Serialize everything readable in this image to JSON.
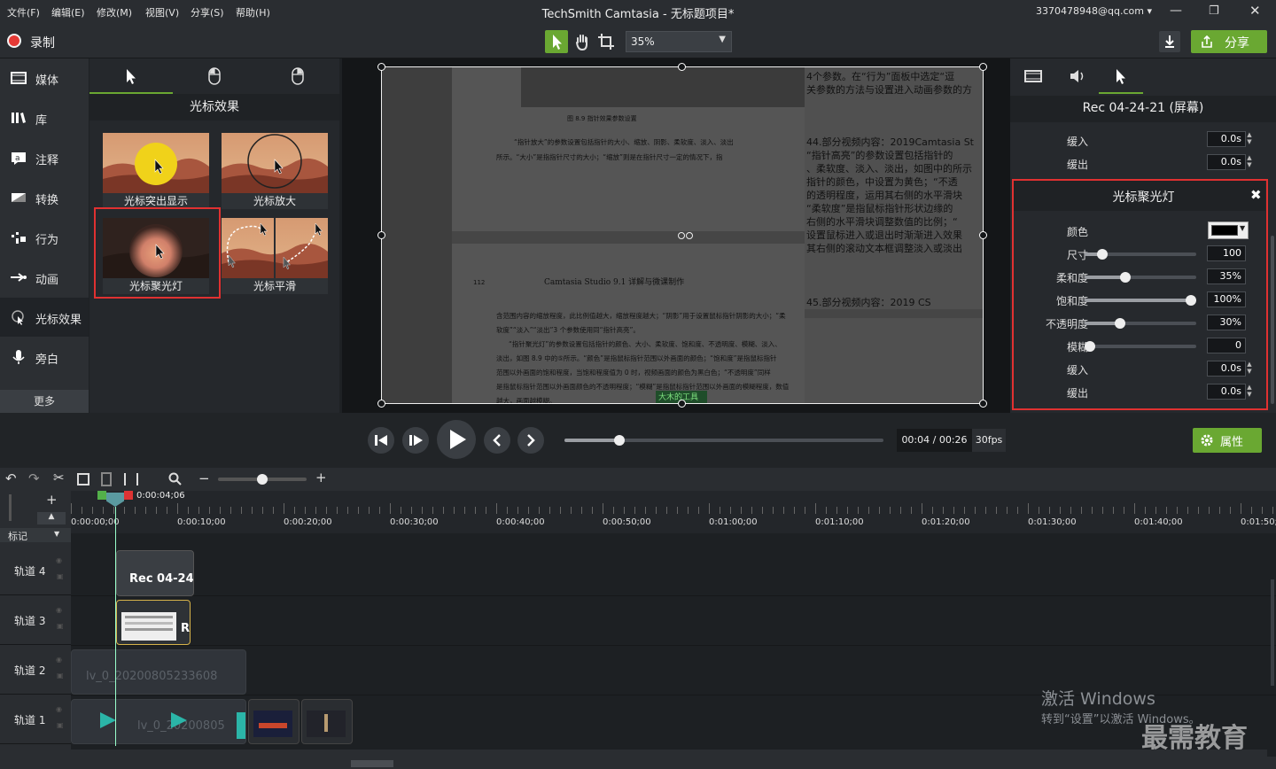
{
  "menu": {
    "file": "文件(F)",
    "edit": "编辑(E)",
    "modify": "修改(M)",
    "view": "视图(V)",
    "share": "分享(S)",
    "help": "帮助(H)"
  },
  "window": {
    "title": "TechSmith Camtasia - 无标题项目*",
    "account": "3370478948@qq.com"
  },
  "toolbar": {
    "record": "录制",
    "zoom": "35%",
    "share": "分享"
  },
  "nav": [
    {
      "label": "媒体",
      "icon": "film-icon"
    },
    {
      "label": "库",
      "icon": "library-icon"
    },
    {
      "label": "注释",
      "icon": "annotation-icon"
    },
    {
      "label": "转换",
      "icon": "transition-icon"
    },
    {
      "label": "行为",
      "icon": "behavior-icon"
    },
    {
      "label": "动画",
      "icon": "animation-icon"
    },
    {
      "label": "光标效果",
      "icon": "cursor-effect-icon"
    },
    {
      "label": "旁白",
      "icon": "microphone-icon"
    }
  ],
  "more": "更多",
  "effects": {
    "title": "光标效果",
    "items": [
      "光标突出显示",
      "光标放大",
      "光标聚光灯",
      "光标平滑"
    ]
  },
  "canvas_doc": {
    "caption": "图 8.9 指针效果参数设置",
    "p1": "“指针放大”的参数设置包括指针的大小、缩放、阴影、柔软度、淡入、淡出",
    "p2": "所示。“大小”是指指针尺寸的大小；“缩放”则是在指针尺寸一定的情况下，指",
    "page_no": "112",
    "header": "Camtasia Studio 9.1 详解与微课制作",
    "b1": "含范围内容的缩放程度，此比例值越大，缩放程度越大；“阴影”用于设置鼠标指针阴影的大小；“柔",
    "b2": "软度”“淡入”“淡出”3 个参数使用同“指针高亮”。",
    "b3": "“指针聚光灯”的参数设置包括指针的颜色、大小、柔软度、饱和度、不透明度、模糊、淡入、",
    "b4": "淡出，如图 8.9 中的⑤所示。“颜色”是指鼠标指针范围以外画面的颜色；“饱和度”是指鼠标指针",
    "b5": "范围以外画面的饱和程度，当饱和程度值为 0 时，视频画面的颜色为黑白色；“不透明度”同样",
    "b6": "是指鼠标指针范围以外画面颜色的不透明程度；“模糊”是指鼠标指针范围以外画面的模糊程度，数值",
    "b7": "越大，画面越模糊。",
    "side_top1": "4个参数。在“行为”面板中选定“逗",
    "side_top2": "关参数的方法与设置进入动画参数的方",
    "s1": "44.部分视频内容：2019Camtasia St",
    "s2": "“指针高亮”的参数设置包括指针的",
    "s3": "、柔软度、淡入、淡出，如图中的所示",
    "s4": "指针的颜色，中设置为黄色；“不透",
    "s5": "的透明程度，运用其右侧的水平滑块",
    "s6": "“柔软度”是指鼠标指针形状边缘的",
    "s7": "右侧的水平滑块调整数值的比例；“",
    "s8": "设置鼠标进入或退出时渐渐进入效果",
    "s9": "其右侧的滚动文本框调整淡入或淡出",
    "s10": "45.部分视频内容：2019 CS",
    "green": "大木的工具"
  },
  "props": {
    "clip_title": "Rec 04-24-21 (屏幕)",
    "fade_in_label": "缓入",
    "fade_in": "0.0s",
    "fade_out_label": "缓出",
    "fade_out": "0.0s",
    "effect_title": "光标聚光灯",
    "color_label": "颜色",
    "color_value": "#000000",
    "size_label": "尺寸",
    "size": "100",
    "size_frac": 0.12,
    "soft_label": "柔和度",
    "soft": "35%",
    "soft_frac": 0.35,
    "sat_label": "饱和度",
    "sat": "100%",
    "sat_frac": 1.0,
    "opacity_label": "不透明度",
    "opacity": "30%",
    "opacity_frac": 0.3,
    "blur_label": "模糊",
    "blur": "0",
    "blur_frac": 0.0,
    "e_fade_in_label": "缓入",
    "e_fade_in": "0.0s",
    "e_fade_out_label": "缓出",
    "e_fade_out": "0.0s"
  },
  "player": {
    "time": "00:04 / 00:26",
    "fps": "30fps",
    "properties": "属性",
    "progress": 0.16
  },
  "timeline": {
    "playhead": "0:00:04;06",
    "markers_label": "标记",
    "ruler": [
      "0:00:00;00",
      "0:00:10;00",
      "0:00:20;00",
      "0:00:30;00",
      "0:00:40;00",
      "0:00:50;00",
      "0:01:00;00",
      "0:01:10;00",
      "0:01:20;00",
      "0:01:30;00",
      "0:01:40;00",
      "0:01:50;"
    ],
    "tracks": [
      "轨道 4",
      "轨道 3",
      "轨道 2",
      "轨道 1"
    ],
    "clip4": "Rec 04-24-",
    "clip3": "R",
    "clip2": "lv_0_20200805233608",
    "clip1": "lv_0_20200805"
  },
  "watermark": {
    "line1": "激活 Windows",
    "line2": "转到“设置”以激活 Windows。",
    "brand": "最需教育"
  },
  "colors": {
    "accent": "#6aa832",
    "highlight": "#e03131",
    "panel": "#26292d"
  }
}
